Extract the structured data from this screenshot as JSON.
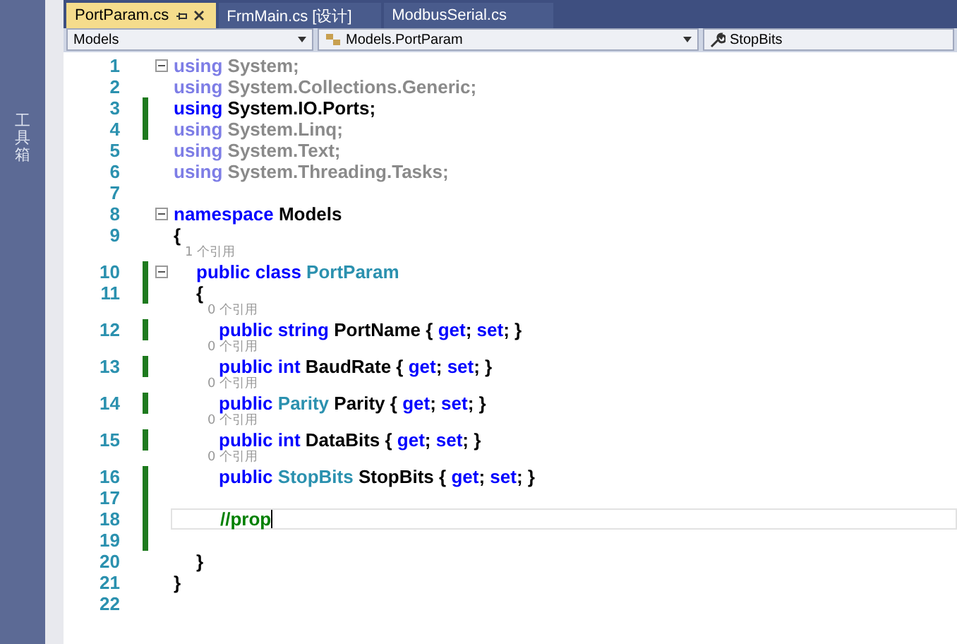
{
  "side_panel": {
    "label": "工具箱"
  },
  "tabs": [
    {
      "label": "PortParam.cs",
      "selected": true,
      "pinnable": true
    },
    {
      "label": "FrmMain.cs [设计]",
      "selected": false,
      "pinnable": false
    },
    {
      "label": "ModbusSerial.cs",
      "selected": false,
      "pinnable": false
    }
  ],
  "nav_bar": {
    "project": "Models",
    "type": "Models.PortParam",
    "member": "StopBits"
  },
  "lines": [
    {
      "number": "1",
      "fold": true,
      "changed": false,
      "current": false,
      "tokens": [
        {
          "kind": "dimkw",
          "text": "using"
        },
        {
          "kind": "dim",
          "text": " System;"
        }
      ]
    },
    {
      "number": "2",
      "fold": false,
      "changed": false,
      "current": false,
      "tokens": [
        {
          "kind": "dimkw",
          "text": "using"
        },
        {
          "kind": "dim",
          "text": " System.Collections.Generic;"
        }
      ]
    },
    {
      "number": "3",
      "fold": false,
      "changed": true,
      "current": false,
      "tokens": [
        {
          "kind": "kw",
          "text": "using"
        },
        {
          "kind": "plain",
          "text": " System.IO.Ports;"
        }
      ]
    },
    {
      "number": "4",
      "fold": false,
      "changed": true,
      "current": false,
      "tokens": [
        {
          "kind": "dimkw",
          "text": "using"
        },
        {
          "kind": "dim",
          "text": " System.Linq;"
        }
      ]
    },
    {
      "number": "5",
      "fold": false,
      "changed": false,
      "current": false,
      "tokens": [
        {
          "kind": "dimkw",
          "text": "using"
        },
        {
          "kind": "dim",
          "text": " System.Text;"
        }
      ]
    },
    {
      "number": "6",
      "fold": false,
      "changed": false,
      "current": false,
      "tokens": [
        {
          "kind": "dimkw",
          "text": "using"
        },
        {
          "kind": "dim",
          "text": " System.Threading.Tasks;"
        }
      ]
    },
    {
      "number": "7",
      "fold": false,
      "changed": false,
      "current": false
    },
    {
      "number": "8",
      "fold": true,
      "changed": false,
      "current": false,
      "tokens": [
        {
          "kind": "kw",
          "text": "namespace"
        },
        {
          "kind": "plain",
          "text": " Models"
        }
      ]
    },
    {
      "number": "9",
      "fold": false,
      "changed": false,
      "current": false,
      "tokens": [
        {
          "kind": "plain",
          "text": "{"
        }
      ],
      "children": [
        {
          "number": "10",
          "fold": true,
          "changed": true,
          "current": false,
          "codelens": "1 个引用",
          "tokens": [
            {
              "kind": "kw",
              "text": "public class"
            },
            {
              "kind": "type",
              "text": " PortParam"
            }
          ]
        },
        {
          "number": "11",
          "fold": false,
          "changed": true,
          "current": false,
          "tokens": [
            {
              "kind": "plain",
              "text": "{"
            }
          ],
          "children": [
            {
              "number": "12",
              "fold": false,
              "changed": true,
              "current": false,
              "codelens": "0 个引用",
              "tokens": [
                {
                  "kind": "kw",
                  "text": "public string"
                },
                {
                  "kind": "plain",
                  "text": " PortName { "
                },
                {
                  "kind": "kw",
                  "text": "get"
                },
                {
                  "kind": "plain",
                  "text": "; "
                },
                {
                  "kind": "kw",
                  "text": "set"
                },
                {
                  "kind": "plain",
                  "text": "; }"
                }
              ]
            },
            {
              "number": "13",
              "fold": false,
              "changed": true,
              "current": false,
              "codelens": "0 个引用",
              "tokens": [
                {
                  "kind": "kw",
                  "text": "public int"
                },
                {
                  "kind": "plain",
                  "text": " BaudRate { "
                },
                {
                  "kind": "kw",
                  "text": "get"
                },
                {
                  "kind": "plain",
                  "text": "; "
                },
                {
                  "kind": "kw",
                  "text": "set"
                },
                {
                  "kind": "plain",
                  "text": "; }"
                }
              ]
            },
            {
              "number": "14",
              "fold": false,
              "changed": true,
              "current": false,
              "codelens": "0 个引用",
              "tokens": [
                {
                  "kind": "kw",
                  "text": "public"
                },
                {
                  "kind": "type",
                  "text": " Parity"
                },
                {
                  "kind": "plain",
                  "text": " Parity { "
                },
                {
                  "kind": "kw",
                  "text": "get"
                },
                {
                  "kind": "plain",
                  "text": "; "
                },
                {
                  "kind": "kw",
                  "text": "set"
                },
                {
                  "kind": "plain",
                  "text": "; }"
                }
              ]
            },
            {
              "number": "15",
              "fold": false,
              "changed": true,
              "current": false,
              "codelens": "0 个引用",
              "tokens": [
                {
                  "kind": "kw",
                  "text": "public int"
                },
                {
                  "kind": "plain",
                  "text": " DataBits { "
                },
                {
                  "kind": "kw",
                  "text": "get"
                },
                {
                  "kind": "plain",
                  "text": "; "
                },
                {
                  "kind": "kw",
                  "text": "set"
                },
                {
                  "kind": "plain",
                  "text": "; }"
                }
              ]
            },
            {
              "number": "16",
              "fold": false,
              "changed": true,
              "current": false,
              "codelens": "0 个引用",
              "tokens": [
                {
                  "kind": "kw",
                  "text": "public"
                },
                {
                  "kind": "type",
                  "text": " StopBits"
                },
                {
                  "kind": "plain",
                  "text": " StopBits { "
                },
                {
                  "kind": "kw",
                  "text": "get"
                },
                {
                  "kind": "plain",
                  "text": "; "
                },
                {
                  "kind": "kw",
                  "text": "set"
                },
                {
                  "kind": "plain",
                  "text": "; }"
                }
              ]
            },
            {
              "number": "17",
              "fold": false,
              "changed": true,
              "current": false
            },
            {
              "number": "18",
              "fold": false,
              "changed": true,
              "current": true,
              "tokens": [
                {
                  "kind": "comment",
                  "text": "//prop"
                }
              ]
            },
            {
              "number": "19",
              "fold": false,
              "changed": true,
              "current": false
            }
          ]
        },
        {
          "number": "20",
          "fold": false,
          "changed": false,
          "current": false,
          "tokens": [
            {
              "kind": "plain",
              "text": "}"
            }
          ]
        }
      ]
    },
    {
      "number": "21",
      "fold": false,
      "changed": false,
      "current": false,
      "tokens": [
        {
          "kind": "plain",
          "text": "}"
        }
      ]
    },
    {
      "number": "22",
      "fold": false,
      "changed": false,
      "current": false
    }
  ]
}
